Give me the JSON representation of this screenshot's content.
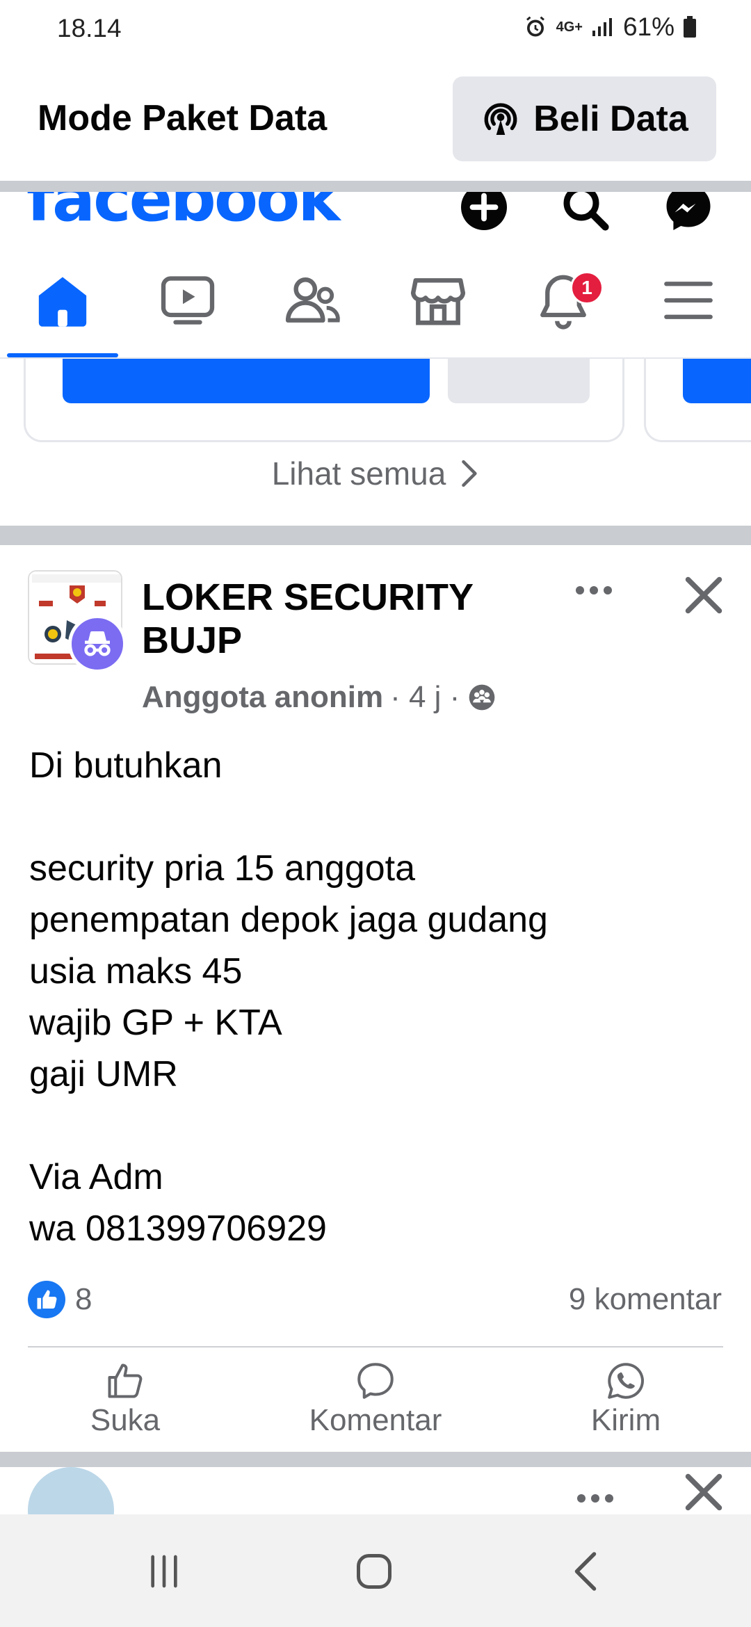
{
  "status_bar": {
    "time": "18.14",
    "network": "4G+",
    "battery": "61%"
  },
  "data_mode": {
    "title": "Mode Paket Data",
    "buy_label": "Beli Data"
  },
  "header": {
    "logo": "facebook"
  },
  "tabs": [
    {
      "name": "home",
      "icon": "home-icon",
      "active": true
    },
    {
      "name": "watch",
      "icon": "video-icon"
    },
    {
      "name": "friends",
      "icon": "friends-icon"
    },
    {
      "name": "marketplace",
      "icon": "store-icon"
    },
    {
      "name": "notifications",
      "icon": "bell-icon",
      "badge": "1"
    },
    {
      "name": "menu",
      "icon": "menu-icon"
    }
  ],
  "stories": {
    "see_all": "Lihat semua"
  },
  "post": {
    "group": "LOKER SECURITY BUJP",
    "author": "Anggota anonim",
    "time": "· 4 j ·",
    "text": "Di butuhkan\n\nsecurity pria 15 anggota\npenempatan depok jaga gudang\nusia maks 45\nwajib GP + KTA\ngaji UMR\n\nVia Adm\nwa 081399706929",
    "reaction_count": "8",
    "comment_count": "9 komentar",
    "actions": {
      "like": "Suka",
      "comment": "Komentar",
      "send": "Kirim"
    }
  },
  "colors": {
    "brand": "#0866ff",
    "badge": "#e41e3f",
    "anon": "#7b6cf2"
  }
}
